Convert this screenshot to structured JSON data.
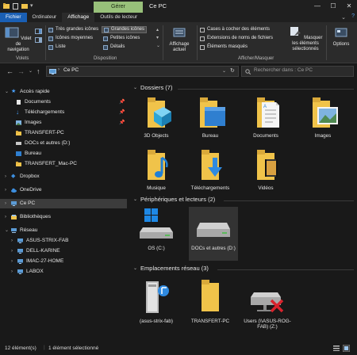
{
  "titlebar": {
    "context_tab": "Gérer",
    "window_title": "Ce PC",
    "controls": [
      "—",
      "☐",
      "✕"
    ]
  },
  "ribbon_tabs": [
    "Fichier",
    "Ordinateur",
    "Affichage",
    "Outils de lecteur"
  ],
  "ribbon": {
    "volets": {
      "big_button": "Volet de navigation",
      "label": "Volets"
    },
    "disposition": {
      "items": [
        "Très grandes icônes",
        "Grandes icônes",
        "Icônes moyennes",
        "Petites icônes",
        "Liste",
        "Détails"
      ],
      "label": "Disposition"
    },
    "affichage_actuel": {
      "big_button": "Affichage actuel"
    },
    "afficher_masquer": {
      "checkboxes": [
        "Cases à cocher des éléments",
        "Extensions de noms de fichiers",
        "Éléments masqués"
      ],
      "hide_button": "Masquer les éléments sélectionnés",
      "label": "Afficher/Masquer"
    },
    "options_button": "Options"
  },
  "address": {
    "path": "Ce PC",
    "search_placeholder": "Rechercher dans : Ce PC"
  },
  "sidebar": {
    "quick_access": "Accès rapide",
    "quick_items": [
      "Documents",
      "Téléchargements",
      "Images",
      "TRANSFERT-PC",
      "DOCs et autres (D:)",
      "Bureau",
      "TRANSFERT_Mac-PC"
    ],
    "dropbox": "Dropbox",
    "onedrive": "OneDrive",
    "this_pc": "Ce PC",
    "libraries": "Bibliothèques",
    "network": "Réseau",
    "network_items": [
      "ASUS-STRIX-FAB",
      "DELL-KARINE",
      "IMAC-27-HOME",
      "LABOX"
    ]
  },
  "main": {
    "folders_header": "Dossiers (7)",
    "folders": [
      "3D Objects",
      "Bureau",
      "Documents",
      "Images",
      "Musique",
      "Téléchargements",
      "Vidéos"
    ],
    "devices_header": "Périphériques et lecteurs (2)",
    "devices": [
      "OS (C:)",
      "DOCs et autres (D:)"
    ],
    "network_header": "Emplacements réseau (3)",
    "network_locations": [
      "(asus-strix-fab)",
      "TRANSFERT-PC",
      "Users (\\\\ASUS-ROG-FAB) (Z:)"
    ]
  },
  "status": {
    "count": "12 élément(s)",
    "selection": "1 élément sélectionné"
  },
  "colors": {
    "folder": "#f0c34a",
    "accent_blue": "#1a5fb4",
    "context_green": "#98c07a",
    "error_red": "#d9232d"
  }
}
